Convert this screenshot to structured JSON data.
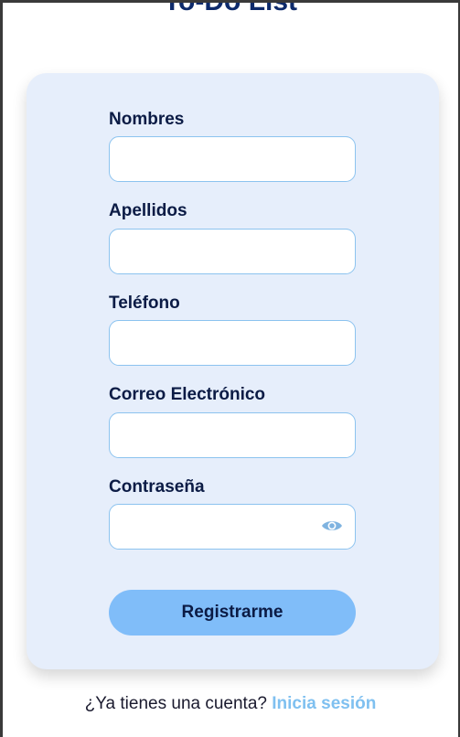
{
  "app": {
    "title": "To-Do List"
  },
  "form": {
    "fields": [
      {
        "label": "Nombres",
        "value": "",
        "placeholder": ""
      },
      {
        "label": "Apellidos",
        "value": "",
        "placeholder": ""
      },
      {
        "label": "Teléfono",
        "value": "",
        "placeholder": ""
      },
      {
        "label": "Correo Electrónico",
        "value": "",
        "placeholder": ""
      },
      {
        "label": "Contraseña",
        "value": "",
        "placeholder": "",
        "icon": "eye-icon"
      }
    ],
    "submit_label": "Registrarme"
  },
  "footer": {
    "prompt": "¿Ya tienes una cuenta?",
    "link_label": "Inicia sesión"
  },
  "colors": {
    "title": "#0d2a6b",
    "card_background": "#e6eefb",
    "label": "#0b1b45",
    "input_border": "#8cc3ef",
    "button": "#80bdf9",
    "link": "#7fc0f0"
  }
}
